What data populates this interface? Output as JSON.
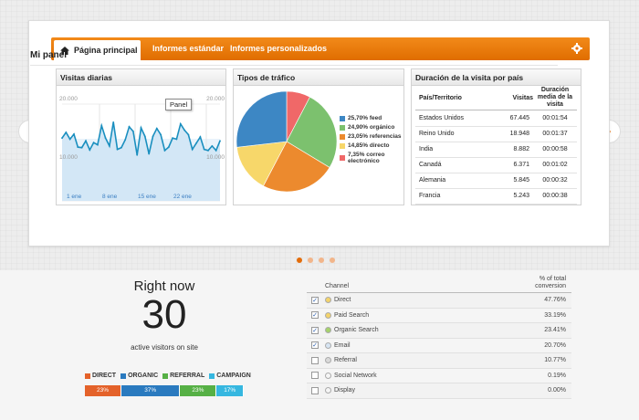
{
  "nav": {
    "home_tab": "Página principal",
    "links": [
      "Informes estándar",
      "Informes personalizados"
    ]
  },
  "panel_title": "Mi panel",
  "tooltip": "Panel",
  "widgets": {
    "daily": {
      "title": "Visitas diarias",
      "y_top": "20.000",
      "y_mid": "10.000",
      "x_labels": [
        "1 ene",
        "8 ene",
        "15 ene",
        "22 ene"
      ]
    },
    "traffic": {
      "title": "Tipos de tráfico",
      "legend": [
        {
          "label": "25,70% feed",
          "color": "#3d87c4"
        },
        {
          "label": "24,90% orgánico",
          "color": "#7cc16e"
        },
        {
          "label": "23,05% referencias",
          "color": "#ec8a2e"
        },
        {
          "label": "14,85% directo",
          "color": "#f7d76a"
        },
        {
          "label": "7,35% correo electrónico",
          "color": "#f06868"
        }
      ]
    },
    "duration": {
      "title": "Duración de la visita por país",
      "headers": [
        "País/Territorio",
        "Visitas",
        "Duración media de la visita"
      ],
      "rows": [
        [
          "Estados Unidos",
          "67.445",
          "00:01:54"
        ],
        [
          "Reino Unido",
          "18.948",
          "00:01:37"
        ],
        [
          "India",
          "8.882",
          "00:00:58"
        ],
        [
          "Canadá",
          "6.371",
          "00:01:02"
        ],
        [
          "Alemania",
          "5.845",
          "00:00:32"
        ],
        [
          "Francia",
          "5.243",
          "00:00:38"
        ]
      ]
    }
  },
  "chart_data": [
    {
      "type": "line",
      "title": "Visitas diarias",
      "x": [
        "1 ene",
        "8 ene",
        "15 ene",
        "22 ene"
      ],
      "ylim": [
        0,
        20000
      ],
      "series": [
        {
          "values": [
            14000,
            15000,
            13800,
            14700,
            12400,
            12300,
            13500,
            11900,
            13200,
            12800,
            16200,
            14000,
            12600,
            16800,
            12000,
            12300,
            13700,
            16000,
            15200,
            11000,
            15800,
            14300,
            11200,
            14300,
            15700,
            14600,
            11800,
            12400,
            14000,
            13800,
            16500,
            15400,
            14600,
            12000,
            13100,
            14200,
            12000,
            11800,
            12600,
            11800,
            13500
          ]
        }
      ]
    },
    {
      "type": "pie",
      "title": "Tipos de tráfico",
      "categories": [
        "feed",
        "orgánico",
        "referencias",
        "directo",
        "correo electrónico"
      ],
      "values": [
        25.7,
        24.9,
        23.05,
        14.85,
        7.35
      ]
    }
  ],
  "carousel": {
    "dots": 4,
    "active": 0
  },
  "right_now": {
    "title": "Right now",
    "count": "30",
    "subtitle": "active visitors on site",
    "legend": [
      {
        "label": "DIRECT",
        "color": "#e4622a"
      },
      {
        "label": "ORGANIC",
        "color": "#2a7abf"
      },
      {
        "label": "REFERRAL",
        "color": "#56b045"
      },
      {
        "label": "CAMPAIGN",
        "color": "#36b7e0"
      }
    ],
    "bar": [
      {
        "label": "23%",
        "value": 23,
        "color": "#e4622a"
      },
      {
        "label": "37%",
        "value": 37,
        "color": "#2a7abf"
      },
      {
        "label": "23%",
        "value": 23,
        "color": "#56b045"
      },
      {
        "label": "17%",
        "value": 17,
        "color": "#36b7e0"
      }
    ]
  },
  "conversion": {
    "col_channel": "Channel",
    "col_pct": "% of total conversion",
    "rows": [
      {
        "name": "Direct",
        "value": "47.76%",
        "checked": true,
        "color": "#f3d36b"
      },
      {
        "name": "Paid Search",
        "value": "33.19%",
        "checked": true,
        "color": "#f3d36b"
      },
      {
        "name": "Organic Search",
        "value": "23.41%",
        "checked": true,
        "color": "#a5d26b"
      },
      {
        "name": "Email",
        "value": "20.70%",
        "checked": true,
        "color": "#d6e4f2"
      },
      {
        "name": "Referral",
        "value": "10.77%",
        "checked": false,
        "color": "#d9d9d9"
      },
      {
        "name": "Social Network",
        "value": "0.19%",
        "checked": false,
        "color": "#f5f5f5"
      },
      {
        "name": "Display",
        "value": "0.00%",
        "checked": false,
        "color": "#f5f5f5"
      }
    ]
  }
}
